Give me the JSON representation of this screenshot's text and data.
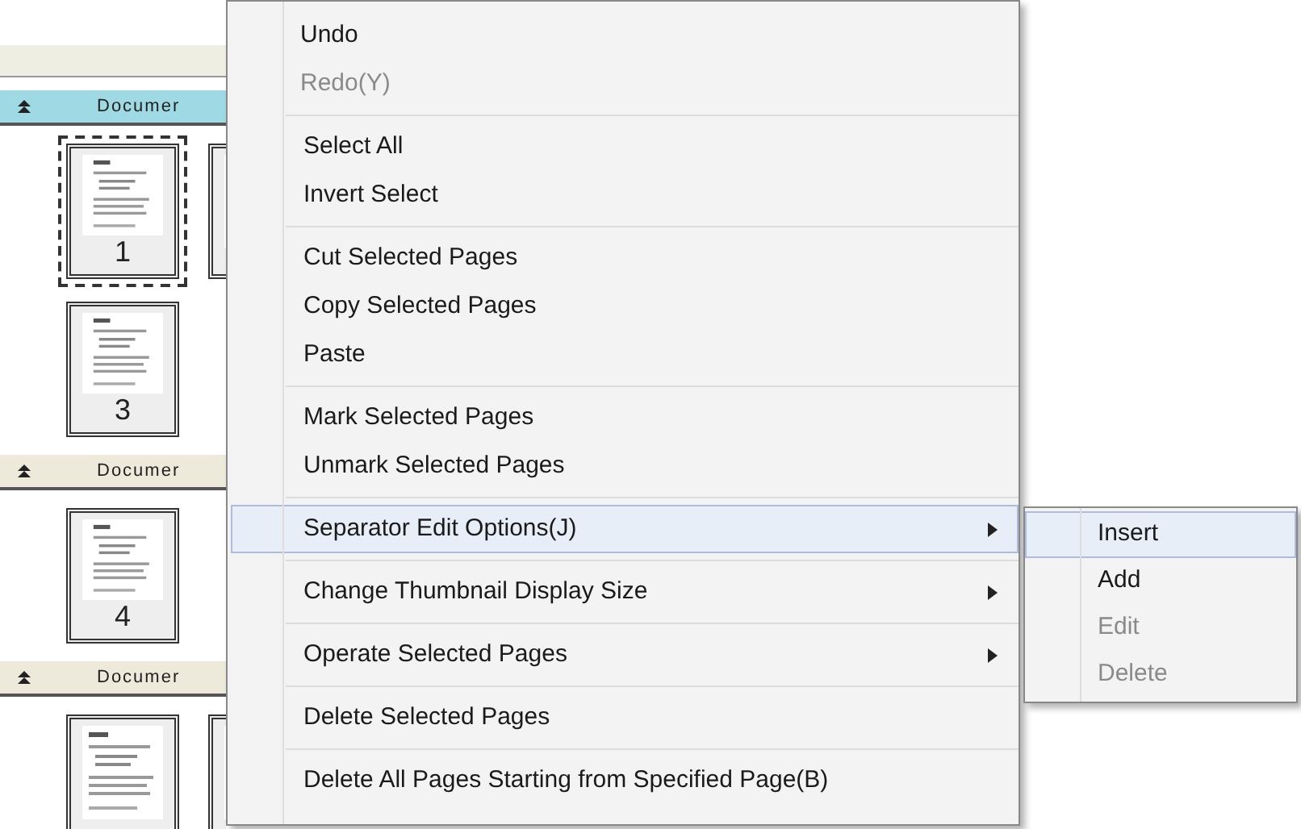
{
  "sidebar": {
    "sections": [
      {
        "title": "Documer",
        "selected": true,
        "rows": [
          [
            {
              "number": "1",
              "selected": true
            },
            {
              "selected": false
            }
          ],
          [
            {
              "number": "3",
              "selected": false
            }
          ]
        ]
      },
      {
        "title": "Documer",
        "selected": false,
        "rows": [
          [
            {
              "number": "4",
              "selected": false
            }
          ]
        ]
      },
      {
        "title": "Documer",
        "selected": false,
        "rows": [
          [
            {
              "selected": false
            },
            {
              "selected": false
            }
          ]
        ]
      }
    ]
  },
  "context_menu": {
    "groups": [
      [
        {
          "label": "Undo",
          "disabled": false,
          "submenu": false,
          "selected": false
        },
        {
          "label": "Redo(Y)",
          "disabled": true,
          "submenu": false,
          "selected": false
        }
      ],
      [
        {
          "label": "Select All",
          "disabled": false,
          "submenu": false,
          "selected": false
        },
        {
          "label": "Invert Select",
          "disabled": false,
          "submenu": false,
          "selected": false
        }
      ],
      [
        {
          "label": "Cut Selected Pages",
          "disabled": false,
          "submenu": false,
          "selected": false
        },
        {
          "label": "Copy Selected Pages",
          "disabled": false,
          "submenu": false,
          "selected": false
        },
        {
          "label": "Paste",
          "disabled": false,
          "submenu": false,
          "selected": false
        }
      ],
      [
        {
          "label": "Mark Selected Pages",
          "disabled": false,
          "submenu": false,
          "selected": false
        },
        {
          "label": "Unmark Selected Pages",
          "disabled": false,
          "submenu": false,
          "selected": false
        }
      ],
      [
        {
          "label": "Separator Edit Options(J)",
          "disabled": false,
          "submenu": true,
          "selected": true
        }
      ],
      [
        {
          "label": "Change Thumbnail Display Size",
          "disabled": false,
          "submenu": true,
          "selected": false
        }
      ],
      [
        {
          "label": "Operate Selected Pages",
          "disabled": false,
          "submenu": true,
          "selected": false
        }
      ],
      [
        {
          "label": "Delete Selected Pages",
          "disabled": false,
          "submenu": false,
          "selected": false
        }
      ],
      [
        {
          "label": "Delete All Pages Starting from Specified Page(B)",
          "disabled": false,
          "submenu": false,
          "selected": false
        }
      ]
    ]
  },
  "submenu": {
    "items": [
      {
        "label": "Insert",
        "disabled": false,
        "selected": true
      },
      {
        "label": "Add",
        "disabled": false,
        "selected": false
      },
      {
        "label": "Edit",
        "disabled": true,
        "selected": false
      },
      {
        "label": "Delete",
        "disabled": true,
        "selected": false
      }
    ]
  }
}
